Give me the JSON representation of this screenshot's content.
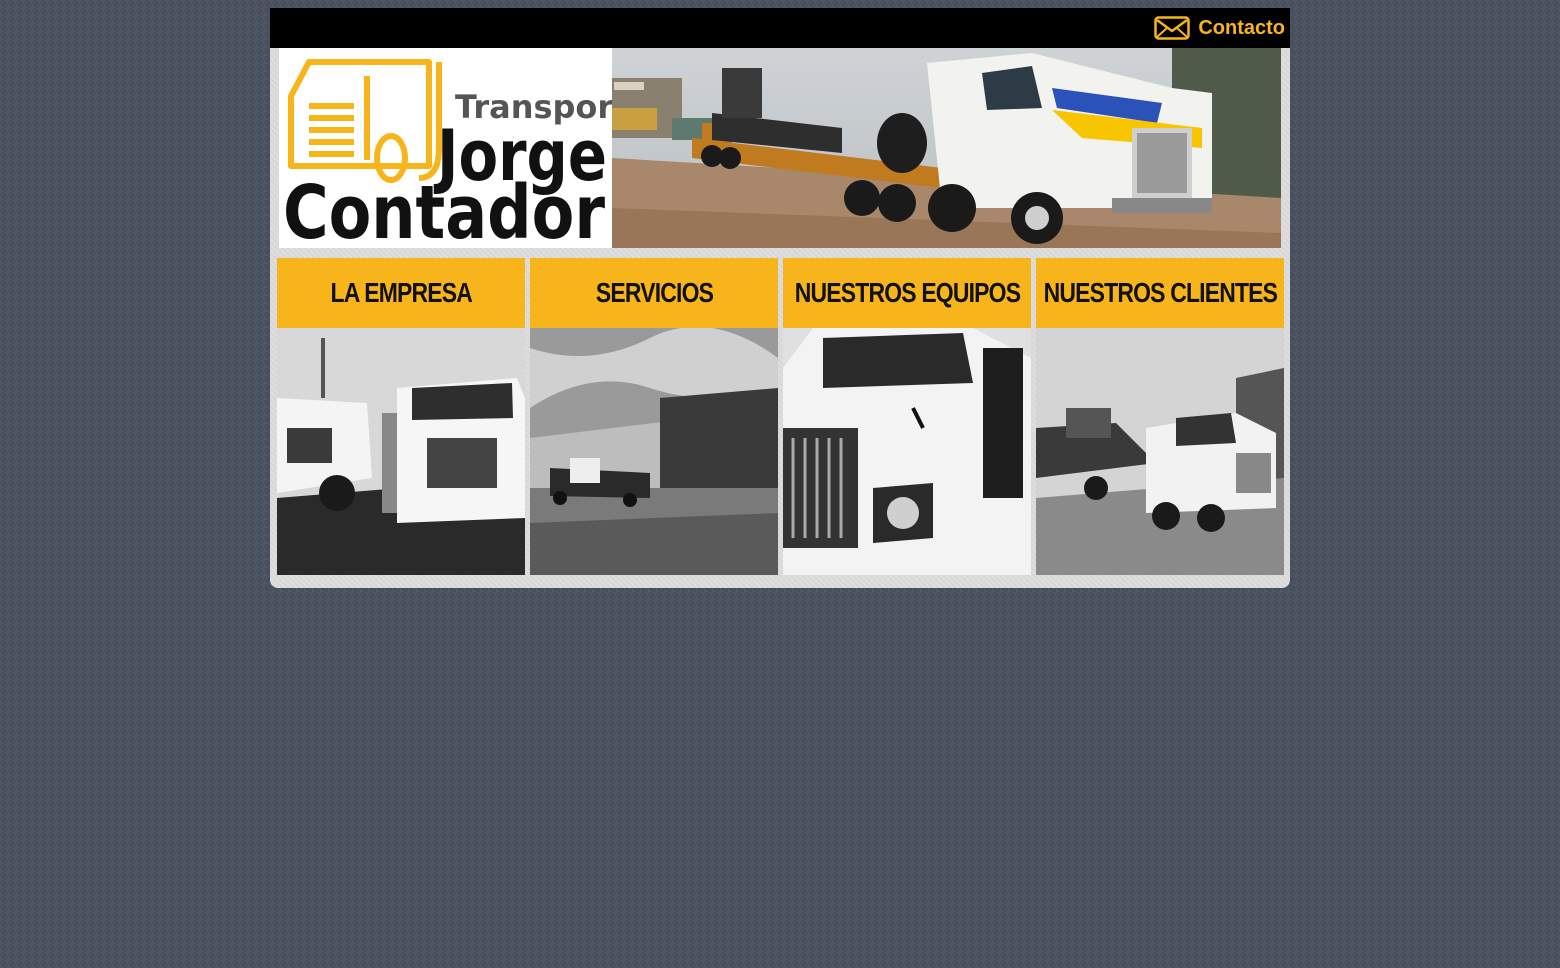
{
  "topbar": {
    "contact_label": "Contacto",
    "contact_icon": "envelope-icon"
  },
  "logo": {
    "line1": "Transportes",
    "line2": "Jorge",
    "line3": "Contador",
    "icon": "truck-outline-icon"
  },
  "colors": {
    "accent": "#f7b51b",
    "background": "#4a5260",
    "topbar": "#000000",
    "panel": "#dedede"
  },
  "nav": {
    "items": [
      {
        "label": "LA EMPRESA"
      },
      {
        "label": "SERVICIOS"
      },
      {
        "label": "NUESTROS EQUIPOS"
      },
      {
        "label": "NUESTROS CLIENTES"
      }
    ]
  }
}
